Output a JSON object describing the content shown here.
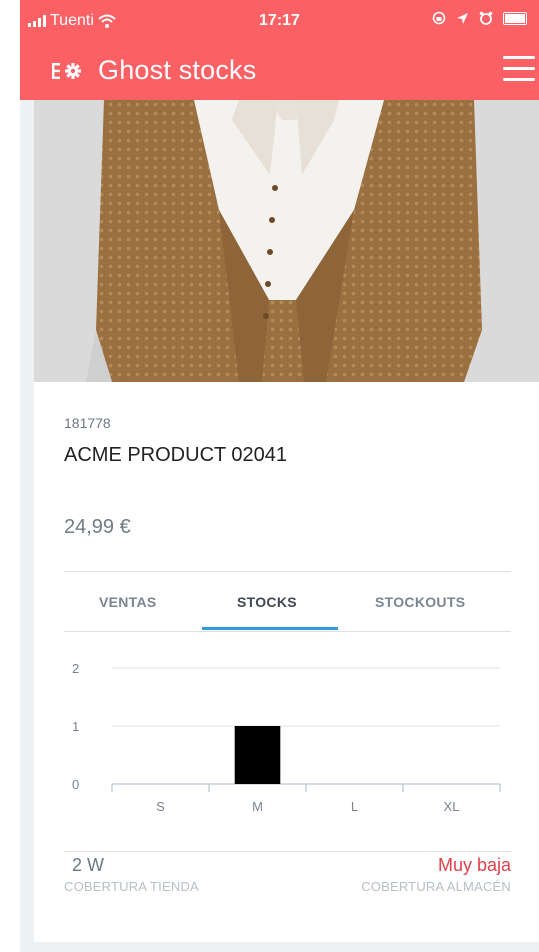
{
  "status_bar": {
    "carrier": "Tuenti",
    "time": "17:17"
  },
  "app_bar": {
    "title": "Ghost stocks",
    "settings_icon": "settings-list-gear-icon",
    "menu_icon": "hamburger-menu-icon"
  },
  "product": {
    "image": "brown-knit-cardigan-photo",
    "sku": "181778",
    "name": "ACME PRODUCT 02041",
    "price": "24,99 €"
  },
  "tabs": [
    {
      "label": "VENTAS",
      "active": false
    },
    {
      "label": "STOCKS",
      "active": true
    },
    {
      "label": "STOCKOUTS",
      "active": false
    }
  ],
  "chart_data": {
    "type": "bar",
    "categories": [
      "S",
      "M",
      "L",
      "XL"
    ],
    "values": [
      0,
      1,
      0,
      0
    ],
    "ylim": [
      0,
      2
    ],
    "yticks": [
      "0",
      "1",
      "2"
    ],
    "grid": true,
    "bar_color": "#000000"
  },
  "coverage": {
    "store_value": "2 W",
    "store_label": "COBERTURA TIENDA",
    "warehouse_value": "Muy baja",
    "warehouse_label": "COBERTURA ALMACÉN"
  },
  "colors": {
    "header": "#fa6064",
    "tab_indicator": "#2f9fdc",
    "alert": "#e0414b"
  }
}
